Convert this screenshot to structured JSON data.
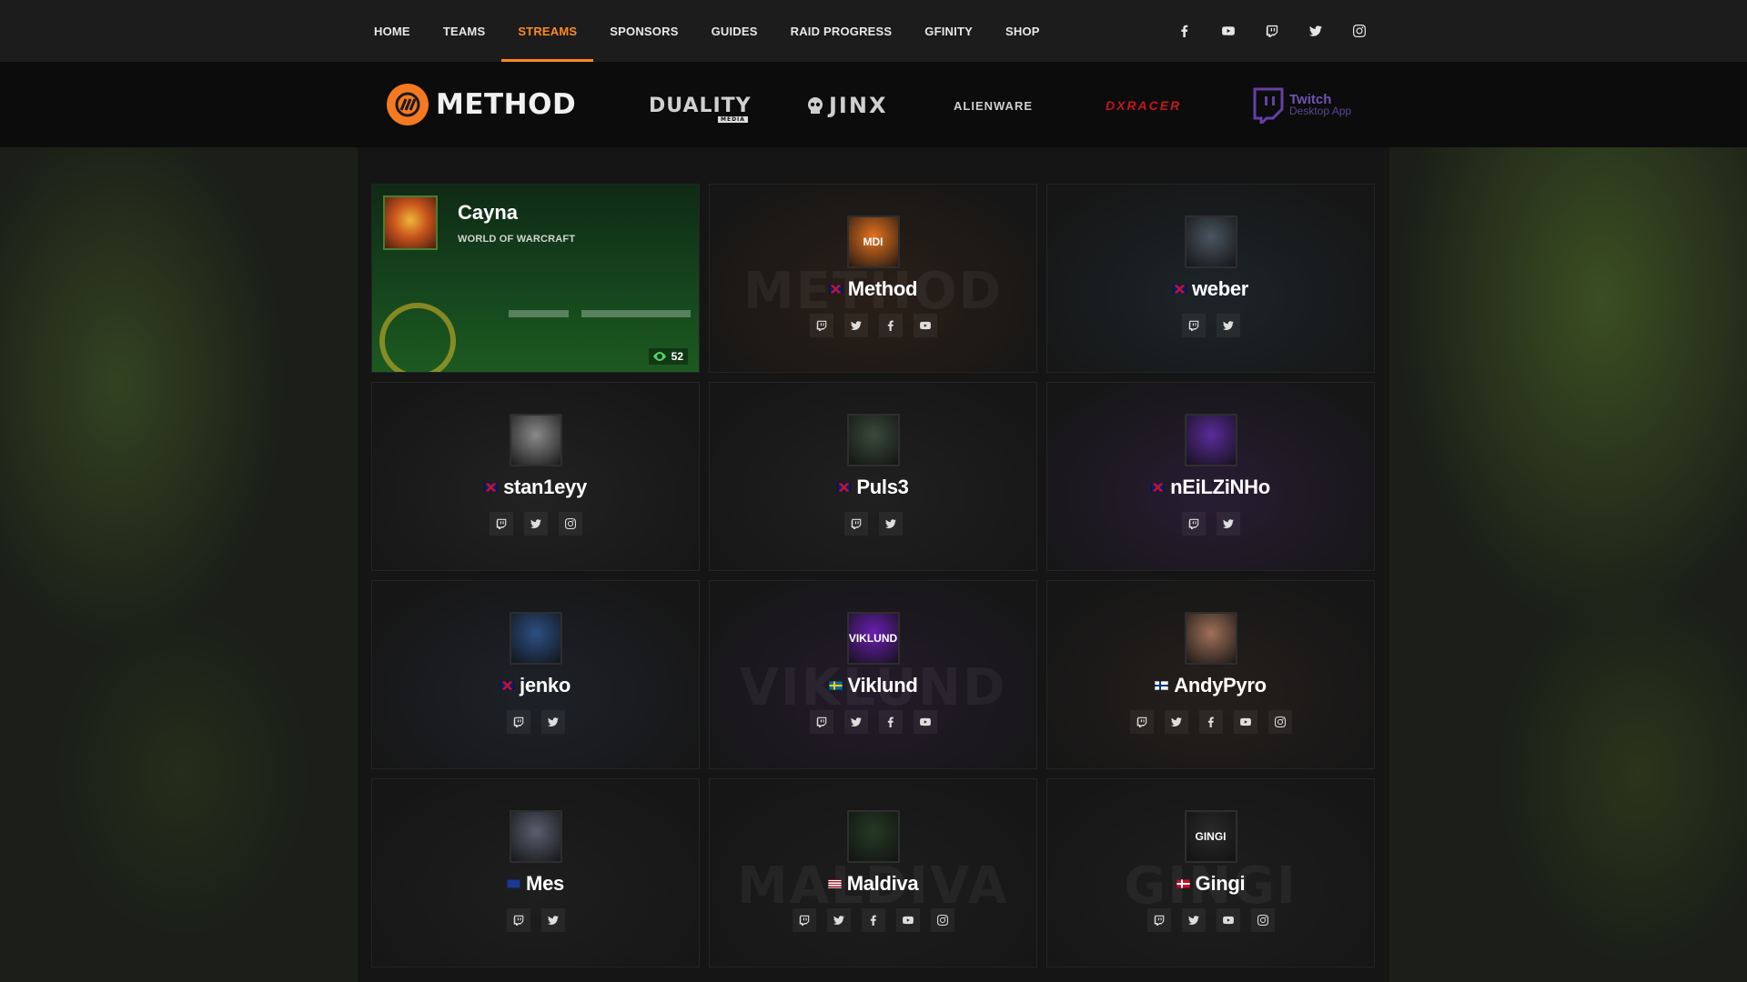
{
  "nav": {
    "items": [
      {
        "label": "HOME",
        "active": false
      },
      {
        "label": "TEAMS",
        "active": false
      },
      {
        "label": "STREAMS",
        "active": true
      },
      {
        "label": "SPONSORS",
        "active": false
      },
      {
        "label": "GUIDES",
        "active": false
      },
      {
        "label": "RAID PROGRESS",
        "active": false
      },
      {
        "label": "GFINITY",
        "active": false
      },
      {
        "label": "SHOP",
        "active": false
      }
    ],
    "social_icons": [
      "facebook-icon",
      "youtube-icon",
      "twitch-icon",
      "twitter-icon",
      "instagram-icon"
    ],
    "accent": "#ff8a1e"
  },
  "sponsors": {
    "brand": "METHOD",
    "duality": "DUALITY",
    "duality_sub": "MEDIA",
    "jinx": "JINX",
    "alienware": "ALIENWARE",
    "dxracer": "DXRACER",
    "twitch_title": "Twitch",
    "twitch_sub": "Desktop App"
  },
  "live_stream": {
    "name": "Cayna",
    "game": "WORLD OF WARCRAFT",
    "viewers": "52"
  },
  "streamers": [
    {
      "name": "Method",
      "flag": "gb",
      "watermark": "METHOD",
      "avatar_color": "#e8741f",
      "avatar_text": "MDI",
      "bg": "#2a1f17",
      "socials": [
        "twitch-icon",
        "twitter-icon",
        "facebook-icon",
        "youtube-icon"
      ]
    },
    {
      "name": "weber",
      "flag": "gb",
      "watermark": "",
      "avatar_color": "#4a5560",
      "avatar_text": "",
      "bg": "#1d2428",
      "socials": [
        "twitch-icon",
        "twitter-icon"
      ]
    },
    {
      "name": "stan1eyy",
      "flag": "gb",
      "watermark": "",
      "avatar_color": "#8a8a8a",
      "avatar_text": "",
      "bg": "#222222",
      "socials": [
        "twitch-icon",
        "twitter-icon",
        "instagram-icon"
      ]
    },
    {
      "name": "Puls3",
      "flag": "gb",
      "watermark": "",
      "avatar_color": "#3a4a3a",
      "avatar_text": "",
      "bg": "#202020",
      "socials": [
        "twitch-icon",
        "twitter-icon"
      ]
    },
    {
      "name": "nEiLZiNHo",
      "flag": "gb",
      "watermark": "",
      "avatar_color": "#5a2b9a",
      "avatar_text": "",
      "bg": "#271d33",
      "socials": [
        "twitch-icon",
        "twitter-icon"
      ]
    },
    {
      "name": "jenko",
      "flag": "gb",
      "watermark": "",
      "avatar_color": "#2d4f84",
      "avatar_text": "",
      "bg": "#1e2128",
      "socials": [
        "twitch-icon",
        "twitter-icon"
      ]
    },
    {
      "name": "Viklund",
      "flag": "se",
      "watermark": "VIKLUND",
      "avatar_color": "#6a1fb3",
      "avatar_text": "VIKLUND",
      "bg": "#231b2a",
      "socials": [
        "twitch-icon",
        "twitter-icon",
        "facebook-icon",
        "youtube-icon"
      ]
    },
    {
      "name": "AndyPyro",
      "flag": "fi",
      "watermark": "",
      "avatar_color": "#a0705a",
      "avatar_text": "",
      "bg": "#241f1c",
      "socials": [
        "twitch-icon",
        "twitter-icon",
        "facebook-icon",
        "youtube-icon",
        "instagram-icon"
      ]
    },
    {
      "name": "Mes",
      "flag": "nz",
      "watermark": "",
      "avatar_color": "#5a5f70",
      "avatar_text": "",
      "bg": "#1e1e1e",
      "socials": [
        "twitch-icon",
        "twitter-icon"
      ]
    },
    {
      "name": "Maldiva",
      "flag": "us",
      "watermark": "MALDIVA",
      "avatar_color": "#253a25",
      "avatar_text": "",
      "bg": "#1d1d1d",
      "socials": [
        "twitch-icon",
        "twitter-icon",
        "facebook-icon",
        "youtube-icon",
        "instagram-icon"
      ]
    },
    {
      "name": "Gingi",
      "flag": "dk",
      "watermark": "GINGI",
      "avatar_color": "#2a2a2a",
      "avatar_text": "GINGI",
      "bg": "#1e1e1e",
      "socials": [
        "twitch-icon",
        "twitter-icon",
        "youtube-icon",
        "instagram-icon"
      ]
    }
  ]
}
